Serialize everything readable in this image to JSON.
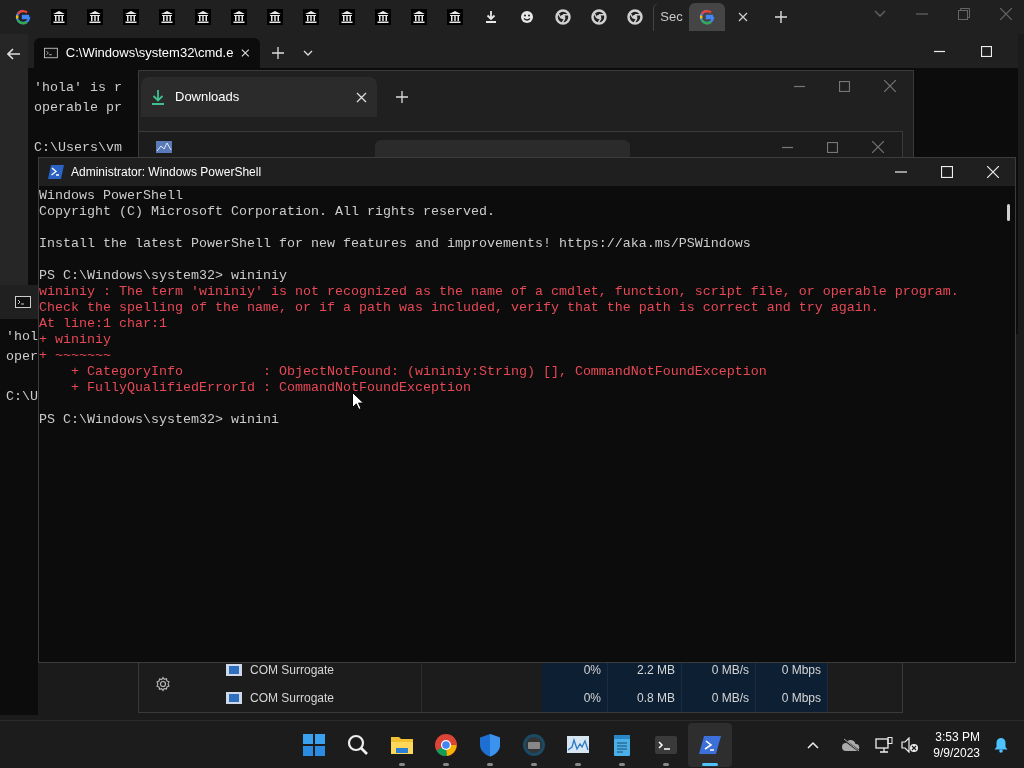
{
  "browser_tab_strip": {
    "tabs": [
      {
        "kind": "google",
        "selected": false
      },
      {
        "kind": "museum",
        "selected": false
      },
      {
        "kind": "museum",
        "selected": false
      },
      {
        "kind": "museum",
        "selected": false
      },
      {
        "kind": "museum",
        "selected": false
      },
      {
        "kind": "museum",
        "selected": false
      },
      {
        "kind": "museum",
        "selected": false
      },
      {
        "kind": "museum",
        "selected": false
      },
      {
        "kind": "museum",
        "selected": false
      },
      {
        "kind": "museum",
        "selected": false
      },
      {
        "kind": "museum",
        "selected": false
      },
      {
        "kind": "museum",
        "selected": false
      },
      {
        "kind": "museum",
        "selected": false
      },
      {
        "kind": "download",
        "selected": false
      },
      {
        "kind": "smiley",
        "selected": false
      },
      {
        "kind": "chrome",
        "selected": false
      },
      {
        "kind": "chrome",
        "selected": false
      },
      {
        "kind": "chrome",
        "selected": false
      },
      {
        "kind": "text",
        "label": "Sec",
        "selected": false
      },
      {
        "kind": "google",
        "selected": true
      }
    ]
  },
  "terminal_window": {
    "tab_title": "C:\\Windows\\system32\\cmd.e",
    "blocks": [
      [
        "'hola' is r",
        "operable pr"
      ],
      [
        "C:\\Users\\vm"
      ]
    ]
  },
  "downloads_window": {
    "tab_title": "Downloads"
  },
  "task_manager": {
    "rows": [
      {
        "name": "COM Surrogate",
        "cpu": "0%",
        "memory": "2.2 MB",
        "disk": "0 MB/s",
        "network": "0 Mbps"
      },
      {
        "name": "COM Surrogate",
        "cpu": "0%",
        "memory": "0.8 MB",
        "disk": "0 MB/s",
        "network": "0 Mbps"
      }
    ]
  },
  "side_cmd_window": {
    "blocks": [
      [
        "'hol",
        "oper"
      ],
      [
        "C:\\U"
      ]
    ]
  },
  "powershell_window": {
    "title": "Administrator: Windows PowerShell",
    "blocks": [
      {
        "lines": [
          {
            "kind": "output",
            "text": "Windows PowerShell"
          },
          {
            "kind": "output",
            "text": "Copyright (C) Microsoft Corporation. All rights reserved."
          }
        ]
      },
      {
        "lines": [
          {
            "kind": "output",
            "text": "Install the latest PowerShell for new features and improvements! https://aka.ms/PSWindows"
          }
        ]
      },
      {
        "lines": [
          {
            "kind": "output",
            "text": "PS C:\\Windows\\system32> wininiy"
          },
          {
            "kind": "error",
            "text": "wininiy : The term 'wininiy' is not recognized as the name of a cmdlet, function, script file, or operable program."
          },
          {
            "kind": "error",
            "text": "Check the spelling of the name, or if a path was included, verify that the path is correct and try again."
          },
          {
            "kind": "error",
            "text": "At line:1 char:1"
          },
          {
            "kind": "error",
            "text": "+ wininiy"
          },
          {
            "kind": "error",
            "text": "+ ~~~~~~~"
          },
          {
            "kind": "error",
            "text": "    + CategoryInfo          : ObjectNotFound: (wininiy:String) [], CommandNotFoundException"
          },
          {
            "kind": "error",
            "text": "    + FullyQualifiedErrorId : CommandNotFoundException"
          }
        ]
      },
      {
        "lines": [
          {
            "kind": "output",
            "text": "PS C:\\Windows\\system32> winini"
          }
        ]
      }
    ]
  },
  "taskbar": {
    "apps": [
      {
        "kind": "start",
        "running": false,
        "selected": false
      },
      {
        "kind": "search",
        "running": false,
        "selected": false
      },
      {
        "kind": "explorer",
        "running": true,
        "selected": false
      },
      {
        "kind": "chrome",
        "running": true,
        "selected": false
      },
      {
        "kind": "shield",
        "running": true,
        "selected": false
      },
      {
        "kind": "camera",
        "running": true,
        "selected": false
      },
      {
        "kind": "monitor",
        "running": true,
        "selected": false
      },
      {
        "kind": "notepad",
        "running": true,
        "selected": false
      },
      {
        "kind": "terminal",
        "running": true,
        "selected": false
      },
      {
        "kind": "powershell",
        "running": true,
        "selected": true
      }
    ],
    "time": "3:53 PM",
    "date": "9/9/2023"
  }
}
